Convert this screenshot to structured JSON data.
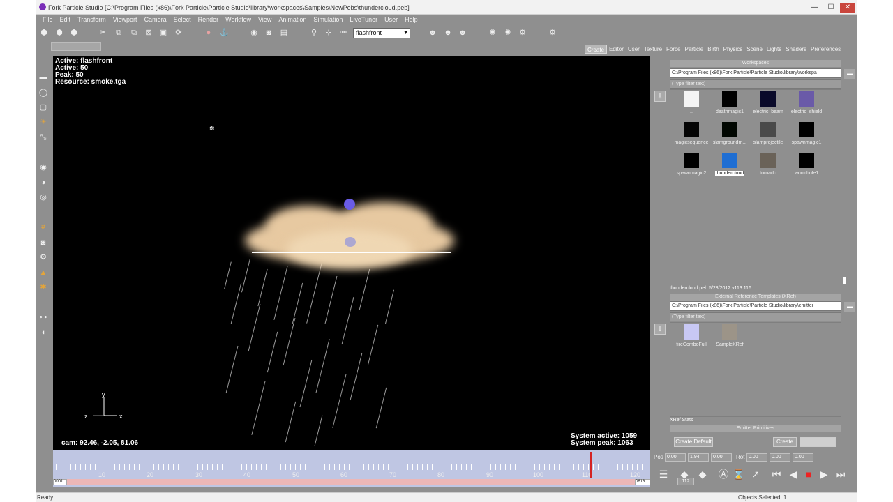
{
  "window": {
    "title": "Fork Particle Studio [C:\\Program Files (x86)\\Fork Particle\\Particle Studio\\library\\workspaces\\Samples\\NewPebs\\thundercloud.peb]",
    "minimize": "—",
    "maximize": "☐",
    "close": "✕"
  },
  "menu": [
    "File",
    "Edit",
    "Transform",
    "Viewport",
    "Camera",
    "Select",
    "Render",
    "Workflow",
    "View",
    "Animation",
    "Simulation",
    "LiveTuner",
    "User",
    "Help"
  ],
  "toolbar": {
    "emitter_name": "flashfront"
  },
  "tabs": [
    "Create",
    "Editor",
    "User",
    "Texture",
    "Force",
    "Particle",
    "Birth",
    "Physics",
    "Scene",
    "Lights",
    "Shaders",
    "Preferences"
  ],
  "viewport": {
    "info": {
      "active_name": "Active: flashfront",
      "active": "Active: 50",
      "peak": "Peak: 50",
      "resource": "Resource: smoke.tga"
    },
    "cam": "cam: 92.46, -2.05, 81.06",
    "system_active": "System active: 1059",
    "system_peak": "System peak: 1063",
    "axis_y": "y",
    "axis_z": "z",
    "axis_x": "x"
  },
  "workspaces": {
    "header": "Workspaces",
    "path": "C:\\Program Files (x86)\\Fork Particle\\Particle Studio\\library\\workspa",
    "filter": "(Type filter text)",
    "items": [
      {
        "label": "..",
        "color": "#f4f4f4"
      },
      {
        "label": "deathmagic1",
        "color": "#000000"
      },
      {
        "label": "electric_beam",
        "color": "#0a0a2a"
      },
      {
        "label": "electric_shield",
        "color": "#6a5aa8"
      },
      {
        "label": "magicsequence",
        "color": "#050505"
      },
      {
        "label": "slamgroundm...",
        "color": "#020802"
      },
      {
        "label": "slamprojectile",
        "color": "#4a4a4a"
      },
      {
        "label": "spawnmagic1",
        "color": "#000000"
      },
      {
        "label": "spawnmagic2",
        "color": "#000000"
      },
      {
        "label": "thundercloud",
        "color": "#1f6ed2"
      },
      {
        "label": "tornado",
        "color": "#6a6258"
      },
      {
        "label": "wormhole1",
        "color": "#000000"
      }
    ],
    "selected": "thundercloud",
    "status": "thundercloud.peb 5/28/2012 v113.116"
  },
  "xref": {
    "header": "External Reference Templates (XRef)",
    "path": "C:\\Program Files (x86)\\Fork Particle\\Particle Studio\\library\\emitter",
    "filter": "(Type filter text)",
    "items": [
      {
        "label": "fireComboFull",
        "color": "#c8c8f4"
      },
      {
        "label": "SampleXRef",
        "color": "#9c9488"
      }
    ],
    "stats": "XRef Stats"
  },
  "primitives": {
    "header": "Emitter Primitives",
    "create_default": "Create Default",
    "create": "Create"
  },
  "timeline": {
    "labels": [
      "10",
      "20",
      "30",
      "40",
      "50",
      "60",
      "70",
      "80",
      "90",
      "100",
      "110",
      "120"
    ],
    "start": "0001",
    "end": "0618"
  },
  "transform": {
    "pos_label": "Pos",
    "pos": [
      "0.00",
      "1.94",
      "0.00"
    ],
    "rot_label": "Rot",
    "rot": [
      "0.00",
      "0.00",
      "0.00"
    ]
  },
  "playback": {
    "frame": "112"
  },
  "status": {
    "left": "Ready",
    "right": "Objects Selected: 1"
  }
}
